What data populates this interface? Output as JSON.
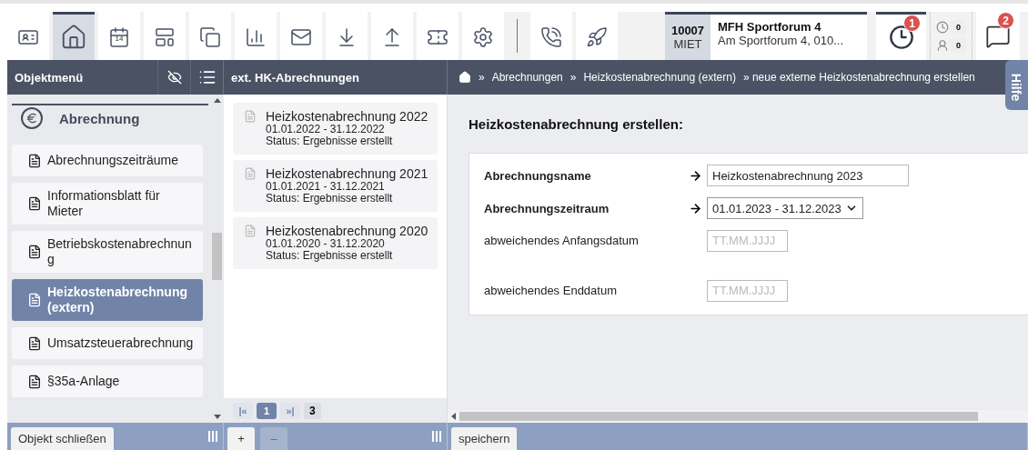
{
  "toolbar": {
    "items": [
      {
        "kind": "button",
        "selected": false
      },
      {
        "kind": "button",
        "selected": true
      },
      {
        "kind": "button",
        "selected": false,
        "text": "14"
      },
      {
        "kind": "button",
        "selected": false
      },
      {
        "kind": "button",
        "selected": false
      },
      {
        "kind": "button",
        "selected": false
      },
      {
        "kind": "button",
        "selected": false
      },
      {
        "kind": "button",
        "selected": false
      },
      {
        "kind": "button",
        "selected": false
      },
      {
        "kind": "button",
        "selected": false
      },
      {
        "kind": "button",
        "selected": false
      },
      {
        "kind": "divider"
      },
      {
        "kind": "button",
        "selected": false
      },
      {
        "kind": "button",
        "selected": false
      }
    ],
    "object": {
      "number": "10007",
      "type": "MIET",
      "name": "MFH Sportforum 4",
      "address": "Am Sportforum 4, 010..."
    },
    "clock_badge": "1",
    "counters": [
      "0",
      "0"
    ],
    "message_badge": "2"
  },
  "sidebar": {
    "title": "Objektmenü",
    "section": "Abrechnung",
    "items": [
      {
        "label": "Abrechnungszeiträume",
        "selected": false
      },
      {
        "label": "Informationsblatt für Mieter",
        "selected": false
      },
      {
        "label": "Betriebskostenabrechnung",
        "selected": false
      },
      {
        "label": "Heizkostenabrechnung (extern)",
        "selected": true
      },
      {
        "label": "Umsatzsteuerabrechnung",
        "selected": false
      },
      {
        "label": "§35a-Anlage",
        "selected": false
      }
    ],
    "close_button": "Objekt schließen"
  },
  "list": {
    "title": "ext. HK-Abrechnungen",
    "items": [
      {
        "title": "Heizkostenabrechnung 2022",
        "period": "01.01.2022 - 31.12.2022",
        "status": "Status: Ergebnisse erstellt"
      },
      {
        "title": "Heizkostenabrechnung 2021",
        "period": "01.01.2021 - 31.12.2021",
        "status": "Status: Ergebnisse erstellt"
      },
      {
        "title": "Heizkostenabrechnung 2020",
        "period": "01.01.2020 - 31.12.2020",
        "status": "Status: Ergebnisse erstellt"
      }
    ],
    "pager": {
      "first": "|«",
      "pages": [
        {
          "label": "1",
          "selected": true
        }
      ],
      "last": "»|",
      "count": "3"
    },
    "buttons": [
      {
        "label": "+",
        "disabled": false
      },
      {
        "label": "–",
        "disabled": true
      }
    ]
  },
  "breadcrumb": {
    "separator": "»",
    "items": [
      "Abrechnungen",
      "Heizkostenabrechnung (extern)"
    ],
    "current": "» neue externe Heizkostenabrechnung erstellen"
  },
  "help_tab": "Hilfe",
  "form": {
    "title": "Heizkostenabrechnung erstellen:",
    "fields": [
      {
        "label": "Abrechnungsname",
        "required": true,
        "kind": "text",
        "value": "Heizkostenabrechnung 2023"
      },
      {
        "label": "Abrechnungszeitraum",
        "required": true,
        "kind": "select",
        "value": "01.01.2023 - 31.12.2023"
      },
      {
        "label": "abweichendes Anfangsdatum",
        "required": false,
        "kind": "date",
        "placeholder": "TT.MM.JJJJ"
      },
      {
        "label": "abweichendes Enddatum",
        "required": false,
        "kind": "date",
        "placeholder": "TT.MM.JJJJ"
      }
    ],
    "save_button": "speichern"
  }
}
